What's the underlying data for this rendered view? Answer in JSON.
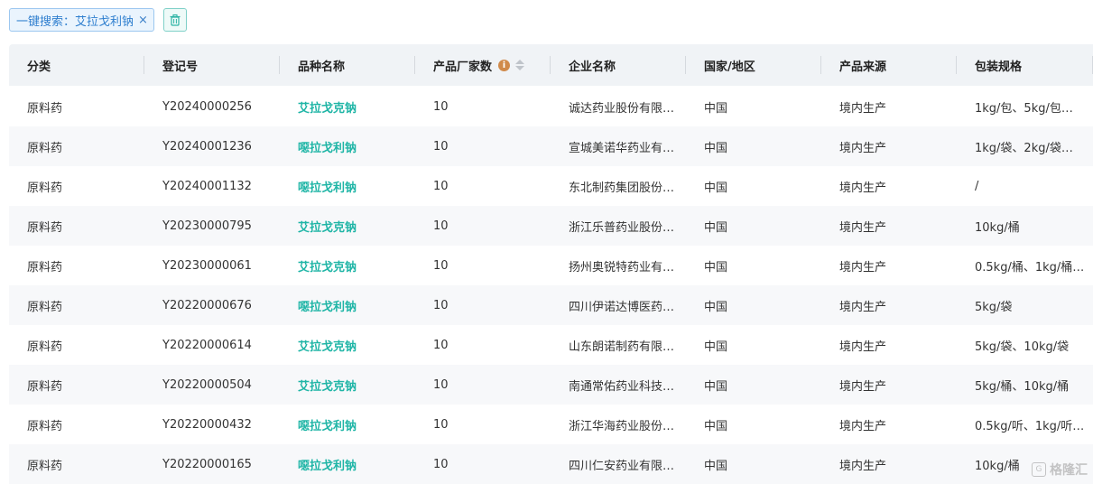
{
  "toolbar": {
    "search_tag_label": "一键搜索：",
    "search_tag_value": "艾拉戈利钠",
    "close_glyph": "×",
    "trash_icon": "trash-icon"
  },
  "table": {
    "columns": [
      "分类",
      "登记号",
      "品种名称",
      "产品厂家数",
      "企业名称",
      "国家/地区",
      "产品来源",
      "包装规格"
    ],
    "rows": [
      [
        "原料药",
        "Y20240000256",
        "艾拉戈克钠",
        "10",
        "诚达药业股份有限…",
        "中国",
        "境内生产",
        "1kg/包、5kg/包…"
      ],
      [
        "原料药",
        "Y20240001236",
        "噁拉戈利钠",
        "10",
        "宣城美诺华药业有…",
        "中国",
        "境内生产",
        "1kg/袋、2kg/袋…"
      ],
      [
        "原料药",
        "Y20240001132",
        "噁拉戈利钠",
        "10",
        "东北制药集团股份…",
        "中国",
        "境内生产",
        "/"
      ],
      [
        "原料药",
        "Y20230000795",
        "艾拉戈克钠",
        "10",
        "浙江乐普药业股份…",
        "中国",
        "境内生产",
        "10kg/桶"
      ],
      [
        "原料药",
        "Y20230000061",
        "艾拉戈克钠",
        "10",
        "扬州奥锐特药业有…",
        "中国",
        "境内生产",
        "0.5kg/桶、1kg/桶…"
      ],
      [
        "原料药",
        "Y20220000676",
        "噁拉戈利钠",
        "10",
        "四川伊诺达博医药…",
        "中国",
        "境内生产",
        "5kg/袋"
      ],
      [
        "原料药",
        "Y20220000614",
        "艾拉戈克钠",
        "10",
        "山东朗诺制药有限…",
        "中国",
        "境内生产",
        "5kg/袋、10kg/袋"
      ],
      [
        "原料药",
        "Y20220000504",
        "艾拉戈克钠",
        "10",
        "南通常佑药业科技…",
        "中国",
        "境内生产",
        "5kg/桶、10kg/桶"
      ],
      [
        "原料药",
        "Y20220000432",
        "噁拉戈利钠",
        "10",
        "浙江华海药业股份…",
        "中国",
        "境内生产",
        "0.5kg/听、1kg/听…"
      ],
      [
        "原料药",
        "Y20220000165",
        "噁拉戈利钠",
        "10",
        "四川仁安药业有限…",
        "中国",
        "境内生产",
        "10kg/桶"
      ]
    ]
  },
  "watermark": {
    "text": "格隆汇",
    "logo_glyph": "G"
  },
  "colors": {
    "link": "#1fb5a6",
    "tag_blue": "#2f7fcf",
    "header_bg": "#f0f3f6",
    "info_icon": "#d08a4a"
  }
}
